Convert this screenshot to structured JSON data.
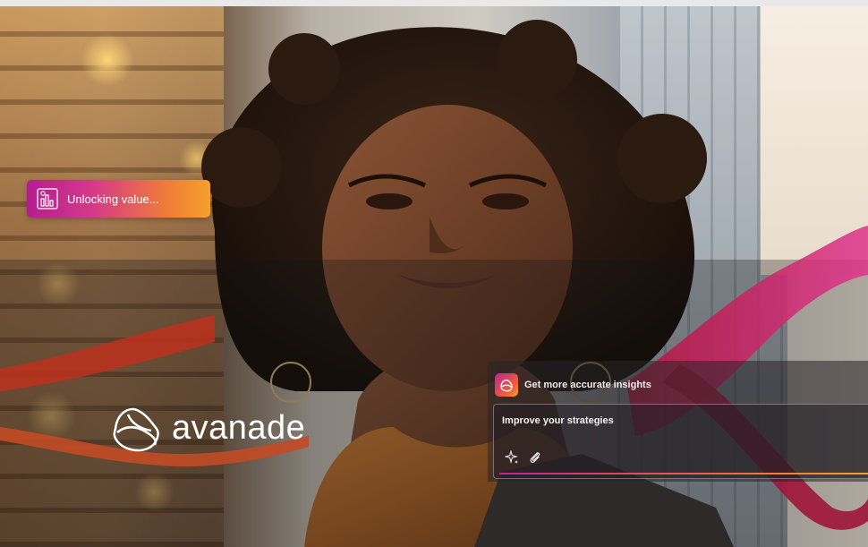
{
  "badge": {
    "label": "Unlocking value...",
    "icon": "analytics-chart-icon"
  },
  "brand": {
    "name": "avanade",
    "mark_icon": "avanade-logo-icon"
  },
  "assistant": {
    "title": "Get more accurate insights",
    "prompt_text": "Improve your strategies",
    "tools": [
      "sparkle-icon",
      "paperclip-icon"
    ]
  },
  "colors": {
    "accent_magenta": "#c2228e",
    "accent_orange": "#f6a02c",
    "ribbon_red": "#b8321e"
  }
}
